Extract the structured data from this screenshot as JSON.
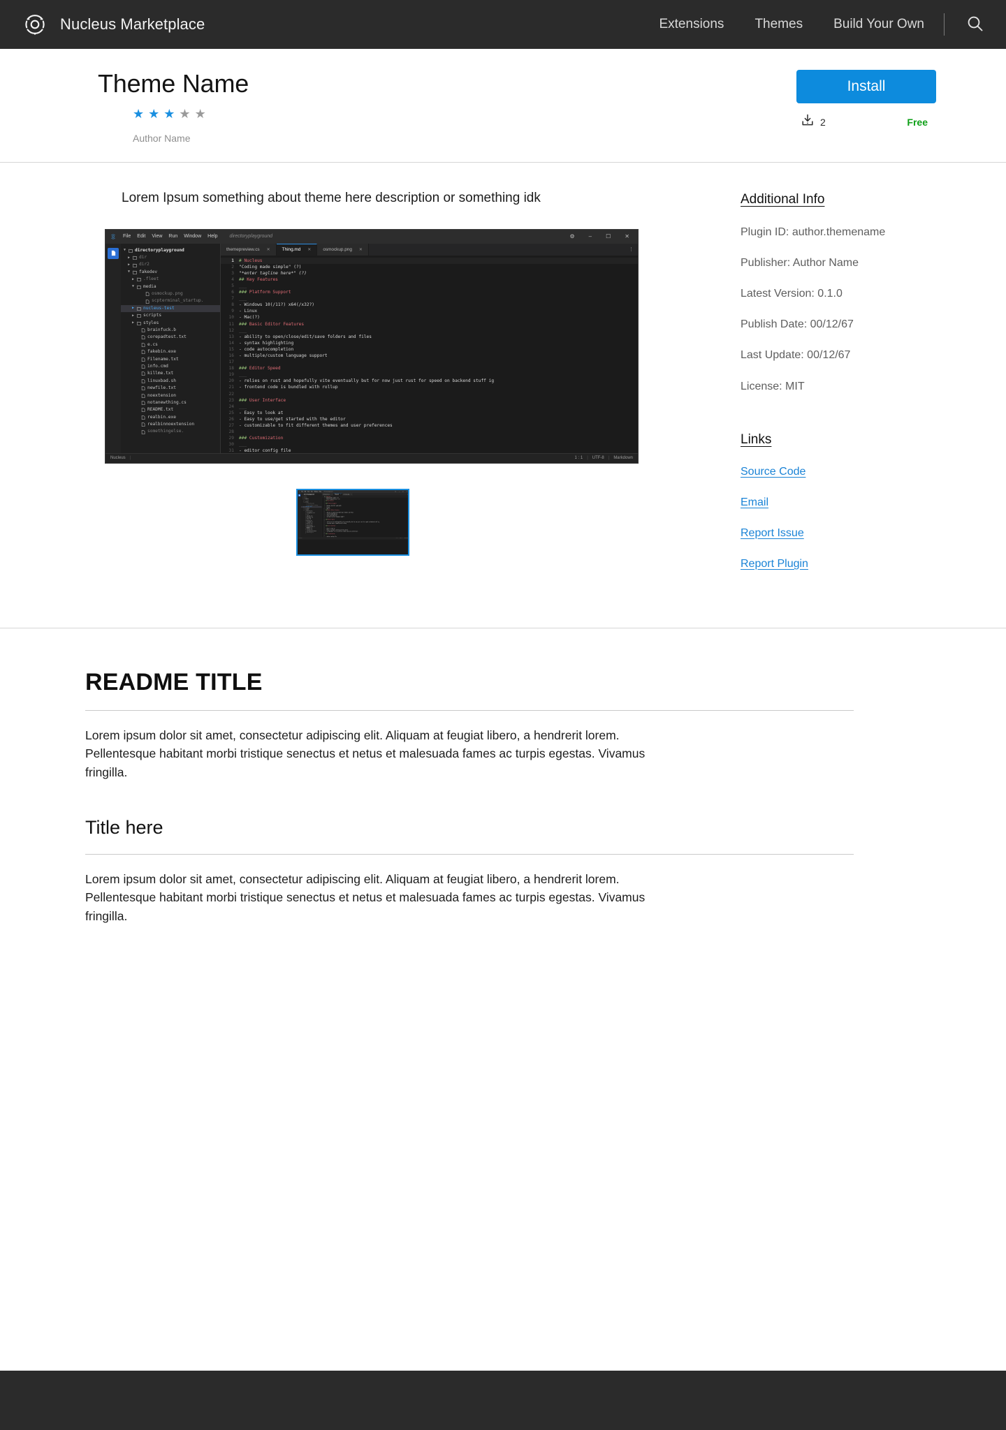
{
  "header": {
    "brand": "Nucleus Marketplace",
    "logo_icon": "atom-logo-icon",
    "nav": [
      {
        "label": "Extensions"
      },
      {
        "label": "Themes"
      },
      {
        "label": "Build Your Own"
      }
    ],
    "search_icon": "search-icon"
  },
  "theme": {
    "title": "Theme Name",
    "author": "Author Name",
    "rating": {
      "value": 3,
      "max": 5,
      "filled_color": "#1a8fe0",
      "empty_color": "#9a9a9a"
    },
    "install_label": "Install",
    "download_icon": "download-icon",
    "download_count": "2",
    "price_label": "Free",
    "price_color": "#0fa018",
    "accent_color": "#0d8bdd"
  },
  "overview": {
    "description": "Lorem Ipsum something about theme here description or something idk"
  },
  "additional_info": {
    "heading": "Additional Info",
    "items": [
      {
        "text": "Plugin ID: author.themename"
      },
      {
        "text": "Publisher: Author Name"
      },
      {
        "text": "Latest Version: 0.1.0"
      },
      {
        "text": "Publish Date: 00/12/67"
      },
      {
        "text": "Last Update: 00/12/67"
      },
      {
        "text": "License: MIT"
      }
    ]
  },
  "links": {
    "heading": "Links",
    "items": [
      {
        "label": "Source Code"
      },
      {
        "label": "Email"
      },
      {
        "label": "Report Issue"
      },
      {
        "label": "Report Plugin"
      }
    ]
  },
  "editor_preview": {
    "logo_icon": "nucleus-logo-icon",
    "menu": [
      "File",
      "Edit",
      "View",
      "Run",
      "Window",
      "Help"
    ],
    "window_path": "directoryplayground",
    "window_controls": [
      {
        "name": "settings-gear-icon",
        "glyph": "⚙"
      },
      {
        "name": "minimize-icon",
        "glyph": "–"
      },
      {
        "name": "maximize-icon",
        "glyph": "☐"
      },
      {
        "name": "close-icon",
        "glyph": "✕"
      }
    ],
    "tabs": [
      {
        "label": "themepreview.cs",
        "active": false
      },
      {
        "label": "Thing.md",
        "active": true
      },
      {
        "label": "osmockup.png",
        "active": false
      }
    ],
    "tabs_more_icon": "overflow-menu-icon",
    "file_tree": [
      {
        "label": "directoryplayground",
        "depth": 0,
        "type": "folder",
        "caret": "open",
        "style": "root"
      },
      {
        "label": "dir",
        "depth": 1,
        "type": "folder",
        "caret": "closed",
        "style": "dim"
      },
      {
        "label": "dir2",
        "depth": 1,
        "type": "folder",
        "caret": "closed",
        "style": "dim"
      },
      {
        "label": "fakedev",
        "depth": 1,
        "type": "folder",
        "caret": "open",
        "style": ""
      },
      {
        "label": ".fleet",
        "depth": 2,
        "type": "folder",
        "caret": "closed",
        "style": "dim"
      },
      {
        "label": "media",
        "depth": 2,
        "type": "folder",
        "caret": "open",
        "style": ""
      },
      {
        "label": "osmockup.png",
        "depth": 4,
        "type": "file",
        "caret": "",
        "style": "dim"
      },
      {
        "label": "scpterminal_startup.",
        "depth": 4,
        "type": "file",
        "caret": "",
        "style": "dim"
      },
      {
        "label": "nucleus-test",
        "depth": 2,
        "type": "folder",
        "caret": "closed",
        "style": "selected"
      },
      {
        "label": "scripts",
        "depth": 2,
        "type": "folder",
        "caret": "closed",
        "style": ""
      },
      {
        "label": "styles",
        "depth": 2,
        "type": "folder",
        "caret": "closed",
        "style": ""
      },
      {
        "label": "brainfuck.b",
        "depth": 3,
        "type": "file",
        "caret": "",
        "style": ""
      },
      {
        "label": "corepadtest.txt",
        "depth": 3,
        "type": "file",
        "caret": "",
        "style": ""
      },
      {
        "label": "e.cs",
        "depth": 3,
        "type": "file",
        "caret": "",
        "style": ""
      },
      {
        "label": "fakebin.exe",
        "depth": 3,
        "type": "file",
        "caret": "",
        "style": ""
      },
      {
        "label": "Filename.txt",
        "depth": 3,
        "type": "file",
        "caret": "",
        "style": ""
      },
      {
        "label": "info.cmd",
        "depth": 3,
        "type": "file",
        "caret": "",
        "style": ""
      },
      {
        "label": "killme.txt",
        "depth": 3,
        "type": "file",
        "caret": "",
        "style": ""
      },
      {
        "label": "linuxbad.sh",
        "depth": 3,
        "type": "file",
        "caret": "",
        "style": ""
      },
      {
        "label": "newfile.txt",
        "depth": 3,
        "type": "file",
        "caret": "",
        "style": ""
      },
      {
        "label": "noextension",
        "depth": 3,
        "type": "file",
        "caret": "",
        "style": ""
      },
      {
        "label": "notanewthing.cs",
        "depth": 3,
        "type": "file",
        "caret": "",
        "style": ""
      },
      {
        "label": "README.txt",
        "depth": 3,
        "type": "file",
        "caret": "",
        "style": ""
      },
      {
        "label": "realbin.exe",
        "depth": 3,
        "type": "file",
        "caret": "",
        "style": ""
      },
      {
        "label": "realbinnoextension",
        "depth": 3,
        "type": "file",
        "caret": "",
        "style": ""
      },
      {
        "label": "somethingelse.",
        "depth": 3,
        "type": "file",
        "caret": "",
        "style": "dim"
      }
    ],
    "code_lines": [
      {
        "n": "1",
        "text": "# Nucleus",
        "kind": "head",
        "current": true
      },
      {
        "n": "2",
        "text": "\"Coding made simple\" (?)",
        "kind": "text"
      },
      {
        "n": "3",
        "text": "\"*enter tagline here*\" (?)",
        "kind": "em"
      },
      {
        "n": "4",
        "text": "## Key Features",
        "kind": "head"
      },
      {
        "n": "5",
        "text": "___",
        "kind": "rule"
      },
      {
        "n": "6",
        "text": "### Platform Support",
        "kind": "head"
      },
      {
        "n": "7",
        "text": "___",
        "kind": "rule"
      },
      {
        "n": "8",
        "text": "- Windows 10(/11?) x64(/x32?)",
        "kind": "text"
      },
      {
        "n": "9",
        "text": "- Linux",
        "kind": "text"
      },
      {
        "n": "10",
        "text": "- Mac(?)",
        "kind": "text"
      },
      {
        "n": "11",
        "text": "### Basic Editor Features",
        "kind": "head"
      },
      {
        "n": "12",
        "text": "___",
        "kind": "rule"
      },
      {
        "n": "13",
        "text": "- ability to open/close/edit/save folders and files",
        "kind": "text"
      },
      {
        "n": "14",
        "text": "- syntax highlighting",
        "kind": "text"
      },
      {
        "n": "15",
        "text": "- code autocompletion",
        "kind": "text"
      },
      {
        "n": "16",
        "text": "- multiple/custom language support",
        "kind": "text"
      },
      {
        "n": "17",
        "text": "",
        "kind": "text"
      },
      {
        "n": "18",
        "text": "### Editor Speed",
        "kind": "head"
      },
      {
        "n": "19",
        "text": "___",
        "kind": "rule"
      },
      {
        "n": "20",
        "text": "- relies on rust and hopefully vite eventually but for now just rust for speed on backend stuff ig",
        "kind": "text"
      },
      {
        "n": "21",
        "text": "- frontend code is bundled with rollup",
        "kind": "text"
      },
      {
        "n": "22",
        "text": "",
        "kind": "text"
      },
      {
        "n": "23",
        "text": "### User Interface",
        "kind": "head"
      },
      {
        "n": "24",
        "text": "___",
        "kind": "rule"
      },
      {
        "n": "25",
        "text": "- Easy to look at",
        "kind": "text"
      },
      {
        "n": "26",
        "text": "- Easy to use/get started with the editor",
        "kind": "text"
      },
      {
        "n": "27",
        "text": "- customizable to fit different themes and user preferences",
        "kind": "text"
      },
      {
        "n": "28",
        "text": "",
        "kind": "text"
      },
      {
        "n": "29",
        "text": "### Customization",
        "kind": "head"
      },
      {
        "n": "30",
        "text": "___",
        "kind": "rule"
      },
      {
        "n": "31",
        "text": "- editor config file",
        "kind": "text"
      }
    ],
    "status": {
      "left": "Nucleus",
      "cursor": "1 : 1",
      "encoding": "UTF-8",
      "language": "Markdown"
    }
  },
  "readme": {
    "title": "README TITLE",
    "paragraph": "Lorem ipsum dolor sit amet, consectetur adipiscing elit. Aliquam at feugiat libero, a hendrerit lorem. Pellentesque habitant morbi tristique senectus et netus et malesuada fames ac turpis egestas. Vivamus fringilla.",
    "sub_title": "Title here",
    "sub_paragraph": "Lorem ipsum dolor sit amet, consectetur adipiscing elit. Aliquam at feugiat libero, a hendrerit lorem. Pellentesque habitant morbi tristique senectus et netus et malesuada fames ac turpis egestas. Vivamus fringilla."
  }
}
